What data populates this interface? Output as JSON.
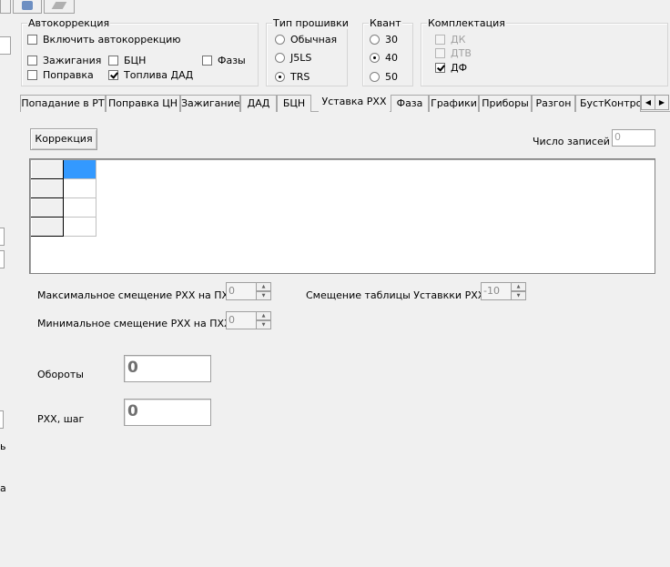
{
  "autocorrection": {
    "title": "Автокоррекция",
    "enable": {
      "label": "Включить автокоррекцию",
      "checked": false
    },
    "ignition": {
      "label": "Зажигания",
      "checked": false
    },
    "bcn": {
      "label": "БЦН",
      "checked": false
    },
    "phases": {
      "label": "Фазы",
      "checked": false
    },
    "correction": {
      "label": "Поправка",
      "checked": false
    },
    "fuel_dad": {
      "label": "Топлива ДАД",
      "checked": true
    }
  },
  "firmware": {
    "title": "Тип прошивки",
    "options": [
      {
        "label": "Обычная",
        "checked": false
      },
      {
        "label": "J5LS",
        "checked": false
      },
      {
        "label": "TRS",
        "checked": true
      }
    ]
  },
  "quant": {
    "title": "Квант",
    "options": [
      {
        "label": "30",
        "checked": false
      },
      {
        "label": "40",
        "checked": true
      },
      {
        "label": "50",
        "checked": false
      }
    ]
  },
  "equipment": {
    "title": "Комплектация",
    "items": [
      {
        "label": "ДК",
        "checked": false,
        "enabled": false
      },
      {
        "label": "ДТВ",
        "checked": false,
        "enabled": false
      },
      {
        "label": "ДФ",
        "checked": true,
        "enabled": true
      }
    ]
  },
  "tabs": [
    {
      "label": "Попадание в РТ"
    },
    {
      "label": "Поправка ЦН"
    },
    {
      "label": "Зажигание"
    },
    {
      "label": "ДАД"
    },
    {
      "label": "БЦН"
    },
    {
      "label": "Уставка РХХ",
      "active": true
    },
    {
      "label": "Фаза"
    },
    {
      "label": "Графики"
    },
    {
      "label": "Приборы"
    },
    {
      "label": "Разгон"
    },
    {
      "label": "БустКонтрол"
    }
  ],
  "panel": {
    "correction_button": "Коррекция",
    "records_label": "Число записей",
    "records_value": "0",
    "max_offset_label": "Максимальное смещение РХХ на ПХХ",
    "max_offset_value": "0",
    "min_offset_label": "Минимальное смещение РХХ на ПХХ",
    "min_offset_value": "0",
    "table_offset_label": "Смещение таблицы Уставкки РХХ",
    "table_offset_value": "-10",
    "rpm_label": "Обороты",
    "rpm_value": "0",
    "rxx_step_label": "РХХ, шаг",
    "rxx_step_value": "0"
  },
  "left_strip": {
    "char1": "ь",
    "char2": "а"
  }
}
